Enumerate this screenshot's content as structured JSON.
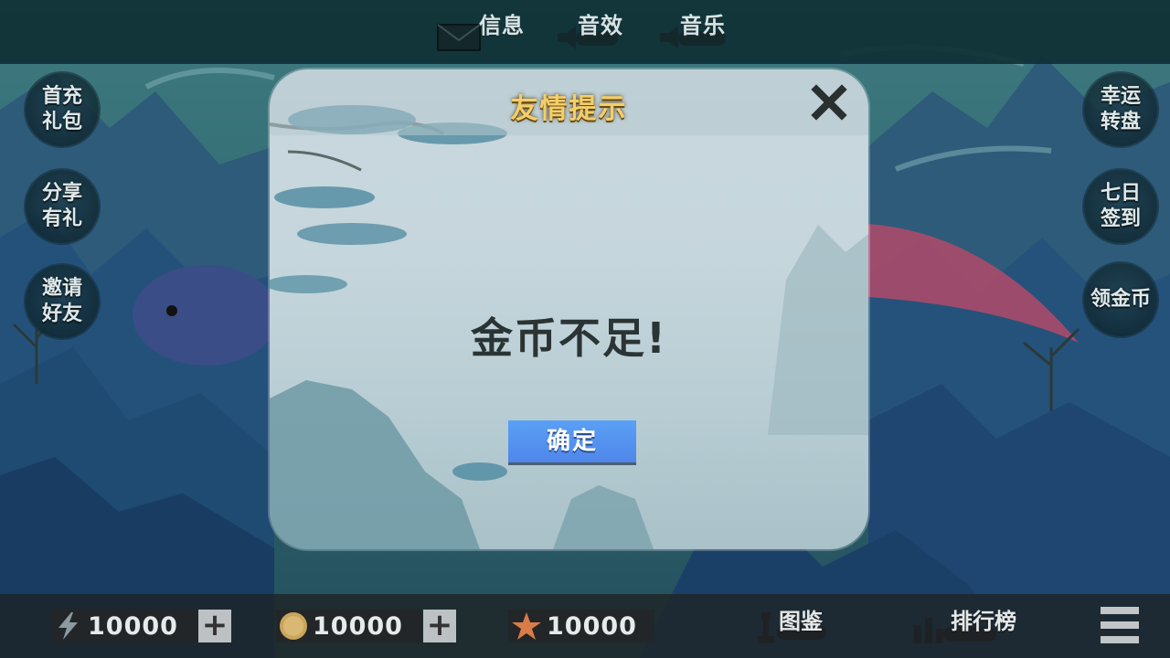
{
  "topbar": {
    "message_label": "信息",
    "sound_label": "音效",
    "music_label": "音乐"
  },
  "left_buttons": {
    "first_recharge_line1": "首充",
    "first_recharge_line2": "礼包",
    "share_line1": "分享",
    "share_line2": "有礼",
    "invite_line1": "邀请",
    "invite_line2": "好友"
  },
  "right_buttons": {
    "lucky_wheel_line1": "幸运",
    "lucky_wheel_line2": "转盘",
    "seven_day_line1": "七日",
    "seven_day_line2": "签到",
    "collect_gold": "领金币"
  },
  "dialog": {
    "title": "友情提示",
    "message": "金币不足!",
    "confirm_label": "确定"
  },
  "bottombar": {
    "energy_value": "10000",
    "coin_value": "10000",
    "star_value": "10000",
    "atlas_label": "图鉴",
    "ranking_label": "排行榜",
    "plus_symbol": "+"
  },
  "colors": {
    "title_gold": "#f3cf6a",
    "confirm_blue": "#5593ef",
    "star_color": "#d97c48",
    "coin_color": "#c9a55c"
  }
}
